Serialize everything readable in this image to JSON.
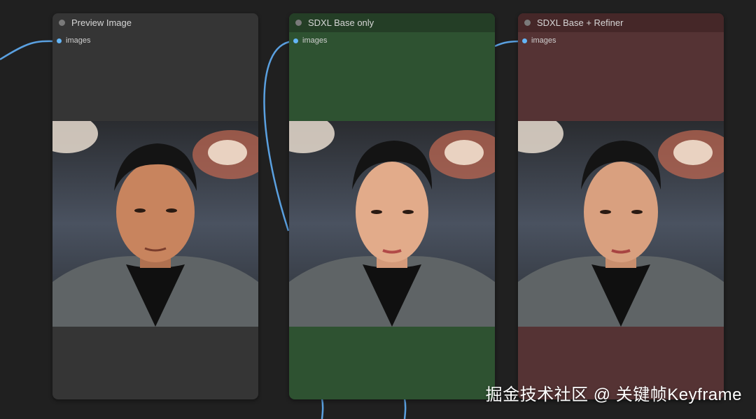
{
  "nodes": [
    {
      "id": "preview",
      "title": "Preview Image",
      "input_label": "images",
      "color": "#353535",
      "image_alt": "portrait-preview"
    },
    {
      "id": "base",
      "title": "SDXL Base only",
      "input_label": "images",
      "color": "#2e5231",
      "image_alt": "portrait-sdxl-base"
    },
    {
      "id": "refiner",
      "title": "SDXL Base + Refiner",
      "input_label": "images",
      "color": "#553334",
      "image_alt": "portrait-sdxl-refiner"
    }
  ],
  "colors": {
    "canvas": "#202020",
    "wire": "#5aa0e0",
    "slot": "#64b5f6"
  },
  "watermark": "掘金技术社区 @ 关键帧Keyframe"
}
